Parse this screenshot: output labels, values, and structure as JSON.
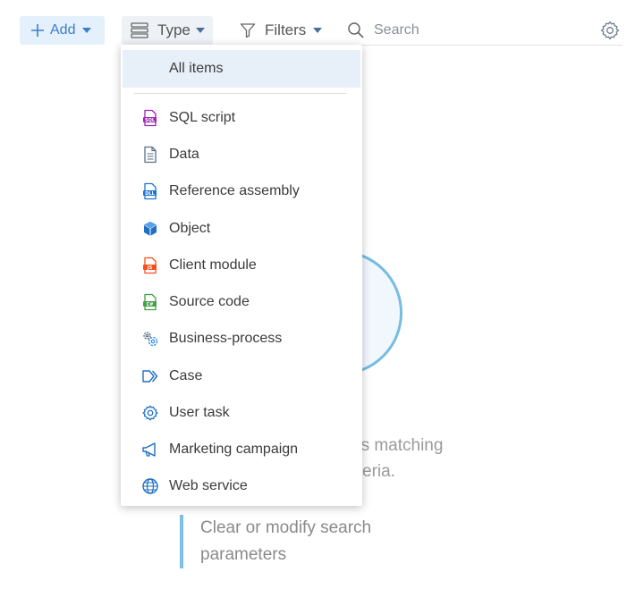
{
  "toolbar": {
    "add_label": "Add",
    "type_label": "Type",
    "filters_label": "Filters",
    "search_placeholder": "Search"
  },
  "dropdown": {
    "all_items": "All items",
    "items": [
      {
        "label": "SQL script",
        "icon": "sql-file-icon"
      },
      {
        "label": "Data",
        "icon": "data-file-icon"
      },
      {
        "label": "Reference assembly",
        "icon": "dll-file-icon"
      },
      {
        "label": "Object",
        "icon": "cube-icon"
      },
      {
        "label": "Client module",
        "icon": "js-file-icon"
      },
      {
        "label": "Source code",
        "icon": "csharp-file-icon"
      },
      {
        "label": "Business-process",
        "icon": "process-gears-icon"
      },
      {
        "label": "Case",
        "icon": "case-arrows-icon"
      },
      {
        "label": "User task",
        "icon": "gear-icon"
      },
      {
        "label": "Marketing campaign",
        "icon": "megaphone-icon"
      },
      {
        "label": "Web service",
        "icon": "globe-icon"
      }
    ]
  },
  "empty_state": {
    "message_line1": "ds matching",
    "message_line2": "eria.",
    "hint": "Clear or modify search parameters"
  },
  "colors": {
    "accent": "#3d7ec7",
    "add_bg": "#e4f0fb",
    "selected_bg": "#e7eff9",
    "empty_circle": "#77bce3"
  }
}
